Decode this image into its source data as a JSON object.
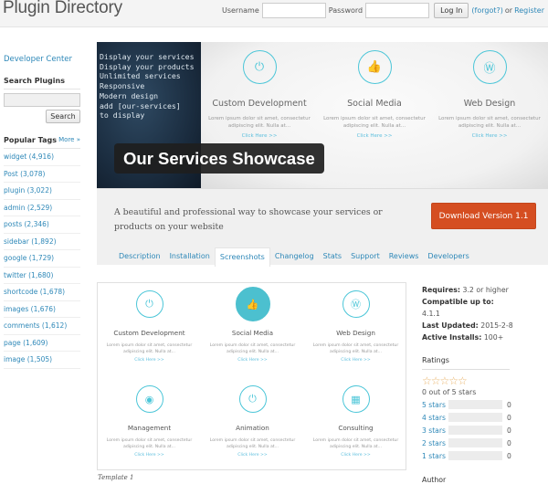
{
  "header": {
    "title": "Plugin Directory",
    "username_label": "Username",
    "username_value": "",
    "password_label": "Password",
    "password_value": "",
    "login_button": "Log In",
    "forgot_link": "(forgot?)",
    "or_text": "or",
    "register_link": "Register"
  },
  "sidebar": {
    "developer_center": "Developer Center",
    "search_heading": "Search Plugins",
    "search_value": "",
    "search_button": "Search",
    "tags_heading": "Popular Tags",
    "more_link": "More »",
    "tags": [
      "widget (4,916)",
      "Post (3,078)",
      "plugin (3,022)",
      "admin (2,529)",
      "posts (2,346)",
      "sidebar (1,892)",
      "google (1,729)",
      "twitter (1,680)",
      "shortcode (1,678)",
      "images (1,676)",
      "comments (1,612)",
      "page (1,609)",
      "image (1,505)"
    ]
  },
  "banner": {
    "features": "Display your services\nDisplay your products\nUnlimited services\nResponsive\nModern design\nadd [our-services]\nto display",
    "label": "Our Services Showcase",
    "services": [
      {
        "icon": "power-icon",
        "glyph": "⏻",
        "title": "Custom Development",
        "desc": "Lorem ipsum dolor sit amet, consectetur adipiscing elit. Nulla at...",
        "link": "Click Here >>"
      },
      {
        "icon": "thumbs-up-icon",
        "glyph": "👍",
        "title": "Social Media",
        "desc": "Lorem ipsum dolor sit amet, consectetur adipiscing elit. Nulla at...",
        "link": "Click Here >>"
      },
      {
        "icon": "wordpress-icon",
        "glyph": "Ⓦ",
        "title": "Web Design",
        "desc": "Lorem ipsum dolor sit amet, consectetur adipiscing elit. Nulla at...",
        "link": "Click Here >>"
      }
    ]
  },
  "plugin": {
    "tagline": "A beautiful and professional way to showcase your services or products on your website",
    "download_button": "Download Version 1.1",
    "accent_color": "#d54e21",
    "tabs": [
      "Description",
      "Installation",
      "Screenshots",
      "Changelog",
      "Stats",
      "Support",
      "Reviews",
      "Developers"
    ],
    "active_tab": "Screenshots"
  },
  "screenshot": {
    "caption": "Template 1",
    "services": [
      {
        "icon": "power-icon",
        "glyph": "⏻",
        "title": "Custom Development",
        "desc": "Lorem ipsum dolor sit amet, consectetur adipiscing elit. Nulla at...",
        "link": "Click Here >>",
        "filled": false
      },
      {
        "icon": "thumbs-up-icon",
        "glyph": "👍",
        "title": "Social Media",
        "desc": "Lorem ipsum dolor sit amet, consectetur adipiscing elit. Nulla at...",
        "link": "Click Here >>",
        "filled": true
      },
      {
        "icon": "wordpress-icon",
        "glyph": "Ⓦ",
        "title": "Web Design",
        "desc": "Lorem ipsum dolor sit amet, consectetur adipiscing elit. Nulla at...",
        "link": "Click Here >>",
        "filled": false
      },
      {
        "icon": "target-icon",
        "glyph": "◉",
        "title": "Management",
        "desc": "Lorem ipsum dolor sit amet, consectetur adipiscing elit. Nulla at...",
        "link": "Click Here >>",
        "filled": false
      },
      {
        "icon": "power-icon",
        "glyph": "⏻",
        "title": "Animation",
        "desc": "Lorem ipsum dolor sit amet, consectetur adipiscing elit. Nulla at...",
        "link": "Click Here >>",
        "filled": false
      },
      {
        "icon": "building-icon",
        "glyph": "▦",
        "title": "Consulting",
        "desc": "Lorem ipsum dolor sit amet, consectetur adipiscing elit. Nulla at...",
        "link": "Click Here >>",
        "filled": false
      }
    ]
  },
  "meta": {
    "requires_label": "Requires:",
    "requires_value": "3.2 or higher",
    "compatible_label": "Compatible up to:",
    "compatible_value": "4.1.1",
    "updated_label": "Last Updated:",
    "updated_value": "2015-2-8",
    "installs_label": "Active Installs:",
    "installs_value": "100+",
    "ratings_heading": "Ratings",
    "stars_glyphs": "☆☆☆☆☆",
    "rating_value": 0,
    "rating_text": "0 out of 5 stars",
    "breakdown": [
      {
        "label": "5 stars",
        "count": "0",
        "fraction": 0
      },
      {
        "label": "4 stars",
        "count": "0",
        "fraction": 0
      },
      {
        "label": "3 stars",
        "count": "0",
        "fraction": 0
      },
      {
        "label": "2 stars",
        "count": "0",
        "fraction": 0
      },
      {
        "label": "1 stars",
        "count": "0",
        "fraction": 0
      }
    ],
    "author_heading": "Author"
  }
}
